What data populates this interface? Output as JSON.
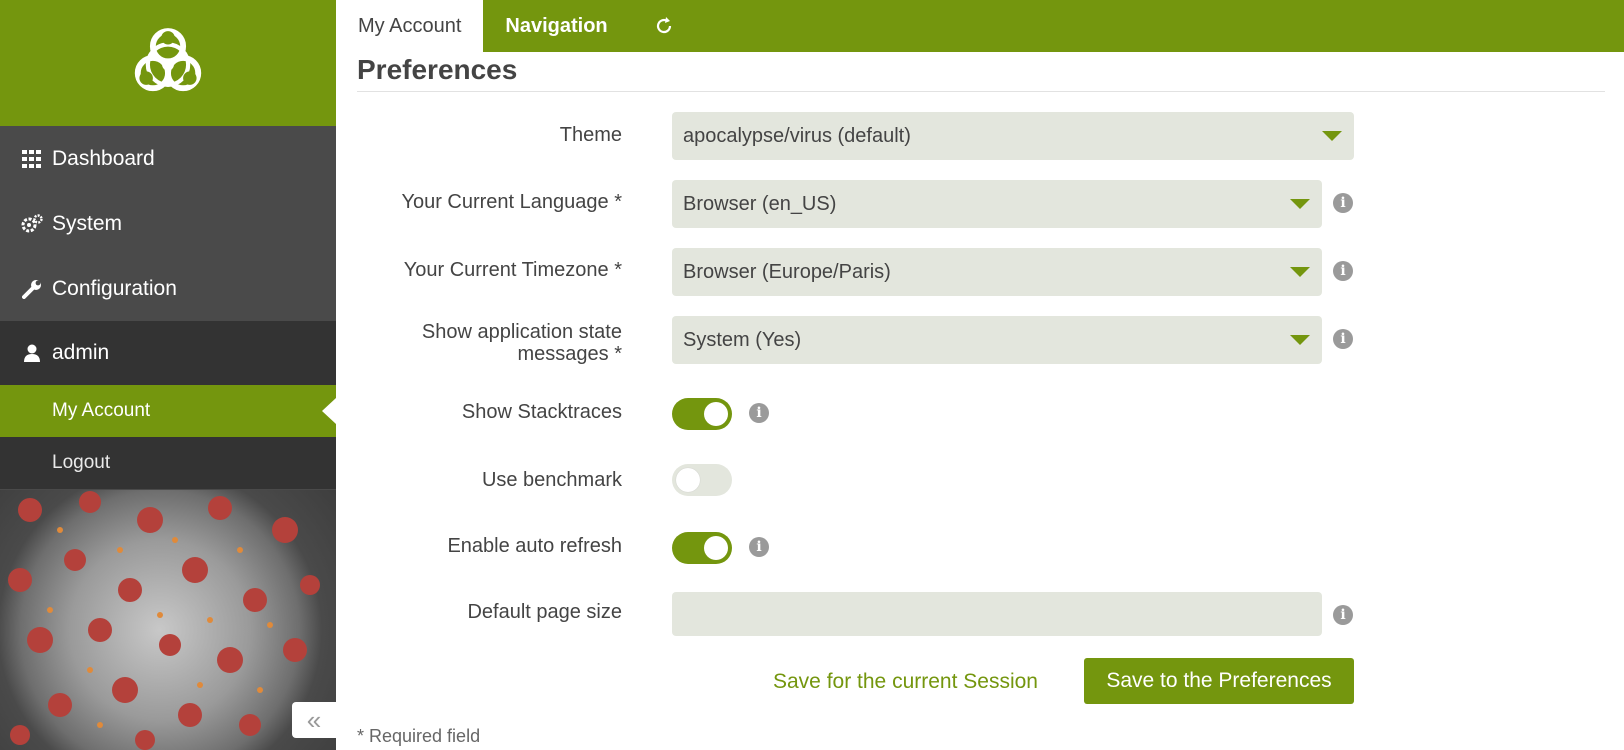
{
  "sidebar": {
    "items": [
      {
        "label": "Dashboard",
        "icon": "grid-icon"
      },
      {
        "label": "System",
        "icon": "gears-icon"
      },
      {
        "label": "Configuration",
        "icon": "wrench-icon"
      },
      {
        "label": "admin",
        "icon": "user-icon"
      }
    ],
    "sub_items": [
      {
        "label": "My Account",
        "active": true
      },
      {
        "label": "Logout",
        "active": false
      }
    ],
    "collapse_icon": "double-chevron-left-icon"
  },
  "tabs": [
    {
      "label": "My Account",
      "active": true
    },
    {
      "label": "Navigation",
      "active": false
    },
    {
      "label": "",
      "icon": "refresh-icon"
    }
  ],
  "page_title": "Preferences",
  "form": {
    "theme": {
      "label": "Theme",
      "value": "apocalypse/virus (default)"
    },
    "language": {
      "label": "Your Current Language *",
      "value": "Browser (en_US)"
    },
    "timezone": {
      "label": "Your Current Timezone *",
      "value": "Browser (Europe/Paris)"
    },
    "app_state": {
      "label_line1": "Show application state",
      "label_line2": "messages *",
      "value": "System (Yes)"
    },
    "stacktraces": {
      "label": "Show Stacktraces",
      "on": true
    },
    "benchmark": {
      "label": "Use benchmark",
      "on": false
    },
    "auto_refresh": {
      "label": "Enable auto refresh",
      "on": true
    },
    "page_size": {
      "label": "Default page size",
      "value": ""
    }
  },
  "actions": {
    "save_session": "Save for the current Session",
    "save_preferences": "Save to the Preferences"
  },
  "footnote": "* Required field",
  "colors": {
    "accent": "#74960e",
    "sidebar": "#4a4a4a",
    "sidebar_dark": "#333333",
    "field_bg": "#e3e6dd"
  }
}
